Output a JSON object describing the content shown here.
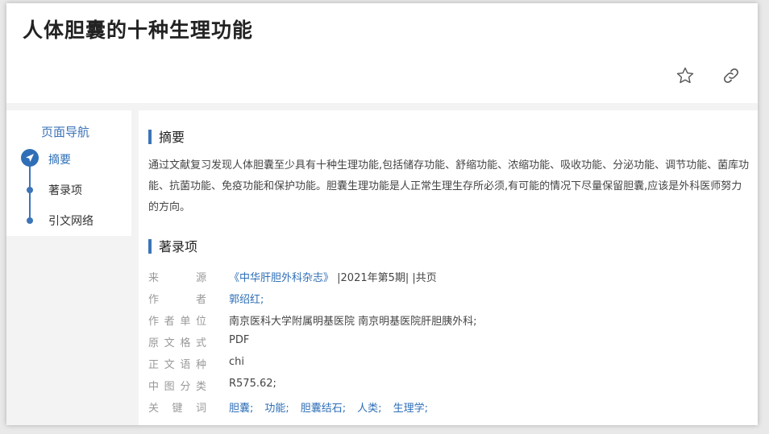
{
  "header": {
    "title": "人体胆囊的十种生理功能"
  },
  "icons": {
    "favorite": "star-outline-icon",
    "share_link": "link-icon"
  },
  "nav": {
    "title": "页面导航",
    "items": [
      {
        "label": "摘要",
        "active": true
      },
      {
        "label": "著录项",
        "active": false
      },
      {
        "label": "引文网络",
        "active": false
      }
    ]
  },
  "abstract": {
    "heading": "摘要",
    "text": "通过文献复习发现人体胆囊至少具有十种生理功能,包括储存功能、舒缩功能、浓缩功能、吸收功能、分泌功能、调节功能、菌库功能、抗菌功能、免疫功能和保护功能。胆囊生理功能是人正常生理生存所必须,有可能的情况下尽量保留胆囊,应该是外科医师努力的方向。"
  },
  "record": {
    "heading": "著录项",
    "source_label": "来源",
    "source_journal": "《中华肝胆外科杂志》",
    "source_issue": " |2021年第5期| |共页",
    "author_label": "作者",
    "author": "郭绍红;",
    "affiliation_label": "作者单位",
    "affiliation": "南京医科大学附属明基医院 南京明基医院肝胆胰外科;",
    "format_label": "原文格式",
    "format": "PDF",
    "language_label": "正文语种",
    "language": "chi",
    "clc_label": "中图分类",
    "clc": "R575.62;",
    "keywords_label": "关键词",
    "keywords": [
      "胆囊;",
      "功能;",
      "胆囊结石;",
      "人类;",
      "生理学;"
    ]
  },
  "colors": {
    "accent": "#3d74b8",
    "link": "#2f6fb7",
    "label": "#999999"
  }
}
